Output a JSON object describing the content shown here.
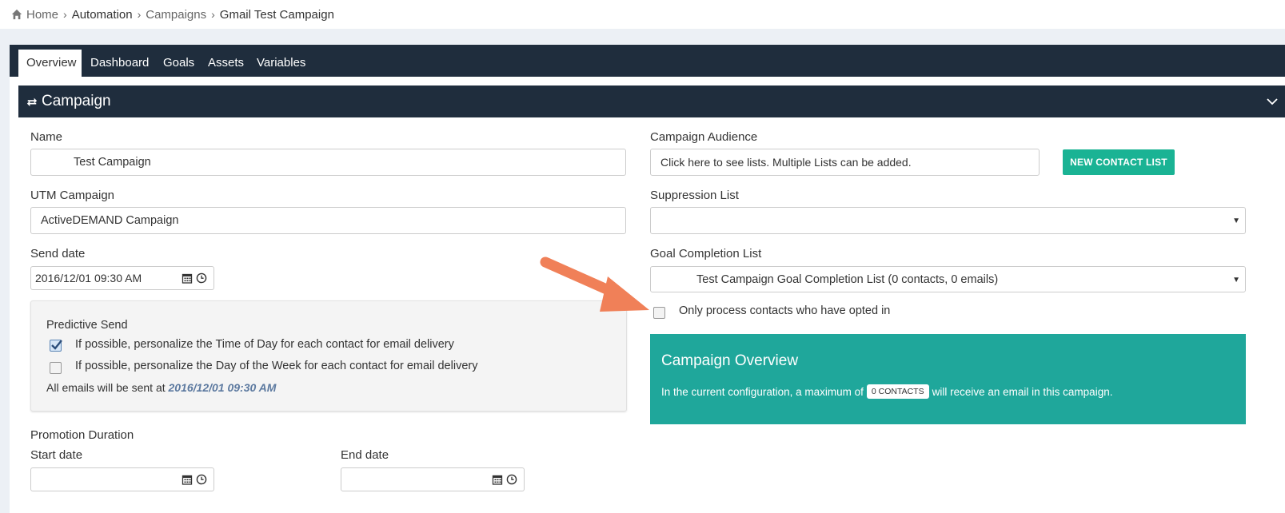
{
  "breadcrumb": {
    "items": [
      "Home",
      "Automation",
      "Campaigns",
      "Gmail Test Campaign"
    ]
  },
  "tabs": [
    "Overview",
    "Dashboard",
    "Goals",
    "Assets",
    "Variables"
  ],
  "box": {
    "title": "Campaign"
  },
  "form": {
    "name_label": "Name",
    "name_value": "Test Campaign",
    "utm_label": "UTM Campaign",
    "utm_value": "ActiveDEMAND Campaign",
    "send_date_label": "Send date",
    "send_date_value": "2016/12/01 09:30 AM",
    "predictive": {
      "title": "Predictive Send",
      "option1": "If possible, personalize the Time of Day for each contact for email delivery",
      "option1_checked": true,
      "option2": "If possible, personalize the Day of the Week for each contact for email delivery",
      "option2_checked": false,
      "summary_prefix": "All emails will be sent at",
      "summary_date": "2016/12/01 09:30 AM"
    },
    "promotion_label": "Promotion Duration",
    "start_date_label": "Start date",
    "start_date_value": "",
    "end_date_label": "End date",
    "end_date_value": "",
    "audience_label": "Campaign Audience",
    "audience_placeholder": "Click here to see lists. Multiple Lists can be added.",
    "new_list_button": "NEW CONTACT LIST",
    "suppression_label": "Suppression List",
    "suppression_value": "",
    "goal_label": "Goal Completion List",
    "goal_value": "Test Campaign Goal Completion List (0 contacts, 0 emails)",
    "opted_in_label": "Only process contacts who have opted in",
    "opted_in_checked": false
  },
  "overview": {
    "title": "Campaign Overview",
    "text_prefix": "In the current configuration, a maximum of",
    "badge": "0 CONTACTS",
    "text_suffix": "will receive an email in this campaign."
  },
  "colors": {
    "header_bg": "#1f2d3d",
    "accent_green": "#1ab394",
    "overview_bg": "#1fa79b",
    "annotation_arrow": "#f08058"
  }
}
